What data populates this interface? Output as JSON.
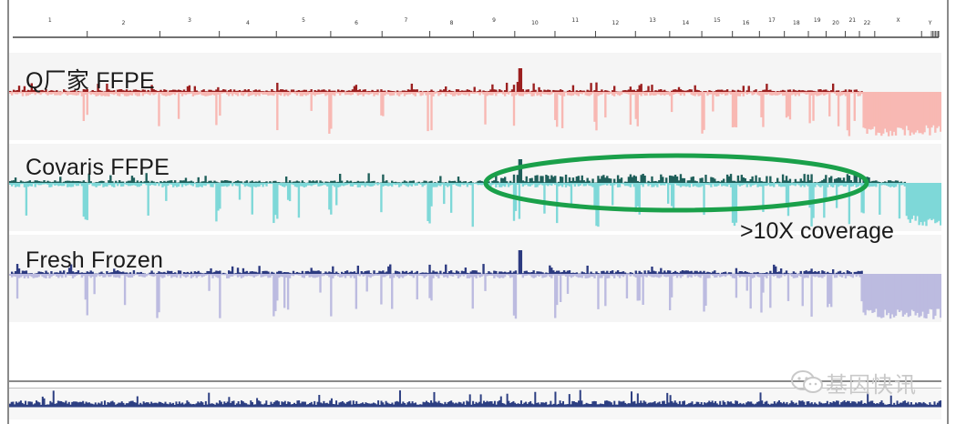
{
  "ruler": {
    "chromosomes": [
      "1",
      "2",
      "3",
      "4",
      "5",
      "6",
      "7",
      "8",
      "9",
      "10",
      "11",
      "12",
      "13",
      "14",
      "15",
      "16",
      "17",
      "18",
      "19",
      "20",
      "21",
      "22",
      "X",
      "Y"
    ],
    "sizes": [
      248,
      242,
      198,
      190,
      181,
      171,
      159,
      145,
      138,
      134,
      135,
      133,
      114,
      107,
      102,
      90,
      83,
      80,
      59,
      64,
      47,
      51,
      156,
      57
    ]
  },
  "tracks": [
    {
      "label": "Q厂家 FFPE",
      "color_pos": "#9b1f1f",
      "color_neg": "#f8b8b3",
      "seed": 11,
      "tail_start": 0.915,
      "tail_depth": 0.92
    },
    {
      "label": "Covaris FFPE",
      "color_pos": "#1f5f5a",
      "color_neg": "#7ed8d8",
      "seed": 29,
      "tail_start": 0.96,
      "tail_depth": 0.9
    },
    {
      "label": "Fresh Frozen",
      "color_pos": "#2c3a80",
      "color_neg": "#bcbbe0",
      "seed": 47,
      "tail_start": 0.915,
      "tail_depth": 0.95
    }
  ],
  "annotation": {
    "text": ">10X coverage",
    "ellipse_color": "#1aa04a"
  },
  "overview": {
    "color": "#2d3f82"
  },
  "watermark": {
    "text": "基因快讯",
    "icon": "wechat-icon"
  }
}
